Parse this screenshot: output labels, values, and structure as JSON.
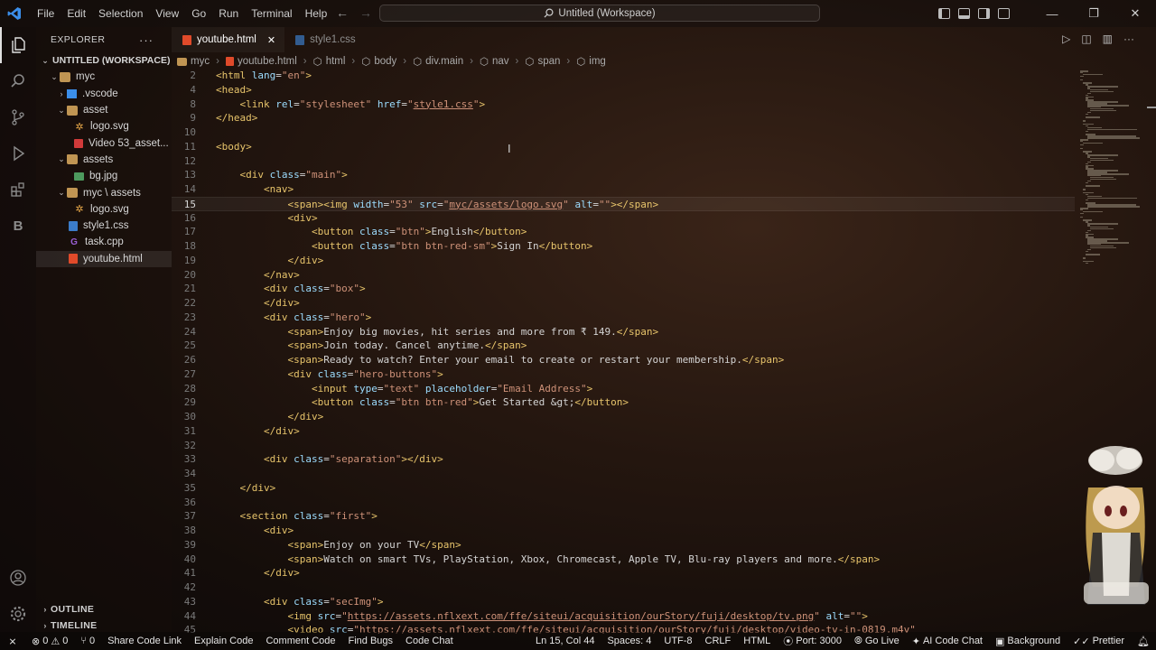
{
  "menu": [
    "File",
    "Edit",
    "Selection",
    "View",
    "Go",
    "Run",
    "Terminal",
    "Help"
  ],
  "command_center": "Untitled (Workspace)",
  "colors": {
    "accent": "#e7c46b",
    "attr": "#9cdcfe",
    "string": "#ce9178",
    "vscode_blue": "#3b8eea"
  },
  "explorer": {
    "title": "EXPLORER",
    "workspace": "UNTITLED (WORKSPACE)",
    "items": [
      {
        "label": "myc",
        "icon": "folder-open-icon"
      },
      {
        "label": ".vscode",
        "icon": "folder-icon"
      },
      {
        "label": "asset",
        "icon": "folder-open-icon"
      },
      {
        "label": "logo.svg",
        "icon": "svg-icon"
      },
      {
        "label": "Video 53_asset...",
        "icon": "video-icon"
      },
      {
        "label": "assets",
        "icon": "folder-open-icon"
      },
      {
        "label": "bg.jpg",
        "icon": "image-icon"
      },
      {
        "label": "myc \\ assets",
        "icon": "folder-open-icon"
      },
      {
        "label": "logo.svg",
        "icon": "svg-icon"
      },
      {
        "label": "style1.css",
        "icon": "css-icon"
      },
      {
        "label": "task.cpp",
        "icon": "cpp-icon"
      },
      {
        "label": "youtube.html",
        "icon": "html-icon"
      }
    ],
    "outline": "OUTLINE",
    "timeline": "TIMELINE"
  },
  "tabs": [
    {
      "label": "youtube.html",
      "active": true
    },
    {
      "label": "style1.css",
      "active": false
    }
  ],
  "breadcrumb": [
    "myc",
    "youtube.html",
    "html",
    "body",
    "div.main",
    "nav",
    "span",
    "img"
  ],
  "code_lines": [
    {
      "n": "2",
      "tokens": [
        [
          "t",
          "<html "
        ],
        [
          "a",
          "lang"
        ],
        [
          "x",
          "="
        ],
        [
          "s",
          "\"en\""
        ],
        [
          "t",
          ">"
        ]
      ]
    },
    {
      "n": "4",
      "tokens": [
        [
          "t",
          "<head>"
        ]
      ]
    },
    {
      "n": "8",
      "tokens": [
        [
          "x",
          "    "
        ],
        [
          "t",
          "<link "
        ],
        [
          "a",
          "rel"
        ],
        [
          "x",
          "="
        ],
        [
          "s",
          "\"stylesheet\""
        ],
        [
          "x",
          " "
        ],
        [
          "a",
          "href"
        ],
        [
          "x",
          "="
        ],
        [
          "s",
          "\""
        ],
        [
          "l",
          "style1.css"
        ],
        [
          "s",
          "\""
        ],
        [
          "t",
          ">"
        ]
      ]
    },
    {
      "n": "9",
      "tokens": [
        [
          "t",
          "</head>"
        ]
      ]
    },
    {
      "n": "10",
      "tokens": []
    },
    {
      "n": "11",
      "tokens": [
        [
          "t",
          "<body>"
        ]
      ]
    },
    {
      "n": "12",
      "tokens": []
    },
    {
      "n": "13",
      "tokens": [
        [
          "x",
          "    "
        ],
        [
          "t",
          "<div "
        ],
        [
          "a",
          "class"
        ],
        [
          "x",
          "="
        ],
        [
          "s",
          "\"main\""
        ],
        [
          "t",
          ">"
        ]
      ]
    },
    {
      "n": "14",
      "tokens": [
        [
          "x",
          "        "
        ],
        [
          "t",
          "<nav>"
        ]
      ]
    },
    {
      "n": "15",
      "current": true,
      "tokens": [
        [
          "x",
          "            "
        ],
        [
          "t",
          "<span><img "
        ],
        [
          "a",
          "width"
        ],
        [
          "x",
          "="
        ],
        [
          "s",
          "\"53\""
        ],
        [
          "x",
          " "
        ],
        [
          "a",
          "src"
        ],
        [
          "x",
          "="
        ],
        [
          "s",
          "\""
        ],
        [
          "l",
          "myc/assets/logo.svg"
        ],
        [
          "s",
          "\""
        ],
        [
          "x",
          " "
        ],
        [
          "a",
          "alt"
        ],
        [
          "x",
          "="
        ],
        [
          "s",
          "\"\""
        ],
        [
          "t",
          "></span>"
        ]
      ]
    },
    {
      "n": "16",
      "tokens": [
        [
          "x",
          "            "
        ],
        [
          "t",
          "<div>"
        ]
      ]
    },
    {
      "n": "17",
      "tokens": [
        [
          "x",
          "                "
        ],
        [
          "t",
          "<button "
        ],
        [
          "a",
          "class"
        ],
        [
          "x",
          "="
        ],
        [
          "s",
          "\"btn\""
        ],
        [
          "t",
          ">"
        ],
        [
          "x",
          "English"
        ],
        [
          "t",
          "</button>"
        ]
      ]
    },
    {
      "n": "18",
      "tokens": [
        [
          "x",
          "                "
        ],
        [
          "t",
          "<button "
        ],
        [
          "a",
          "class"
        ],
        [
          "x",
          "="
        ],
        [
          "s",
          "\"btn btn-red-sm\""
        ],
        [
          "t",
          ">"
        ],
        [
          "x",
          "Sign In"
        ],
        [
          "t",
          "</button>"
        ]
      ]
    },
    {
      "n": "19",
      "tokens": [
        [
          "x",
          "            "
        ],
        [
          "t",
          "</div>"
        ]
      ]
    },
    {
      "n": "20",
      "tokens": [
        [
          "x",
          "        "
        ],
        [
          "t",
          "</nav>"
        ]
      ]
    },
    {
      "n": "21",
      "tokens": [
        [
          "x",
          "        "
        ],
        [
          "t",
          "<div "
        ],
        [
          "a",
          "class"
        ],
        [
          "x",
          "="
        ],
        [
          "s",
          "\"box\""
        ],
        [
          "t",
          ">"
        ]
      ]
    },
    {
      "n": "22",
      "tokens": [
        [
          "x",
          "        "
        ],
        [
          "t",
          "</div>"
        ]
      ]
    },
    {
      "n": "23",
      "tokens": [
        [
          "x",
          "        "
        ],
        [
          "t",
          "<div "
        ],
        [
          "a",
          "class"
        ],
        [
          "x",
          "="
        ],
        [
          "s",
          "\"hero\""
        ],
        [
          "t",
          ">"
        ]
      ]
    },
    {
      "n": "24",
      "tokens": [
        [
          "x",
          "            "
        ],
        [
          "t",
          "<span>"
        ],
        [
          "x",
          "Enjoy big movies, hit series and more from ₹ 149."
        ],
        [
          "t",
          "</span>"
        ]
      ]
    },
    {
      "n": "25",
      "tokens": [
        [
          "x",
          "            "
        ],
        [
          "t",
          "<span>"
        ],
        [
          "x",
          "Join today. Cancel anytime."
        ],
        [
          "t",
          "</span>"
        ]
      ]
    },
    {
      "n": "26",
      "tokens": [
        [
          "x",
          "            "
        ],
        [
          "t",
          "<span>"
        ],
        [
          "x",
          "Ready to watch? Enter your email to create or restart your membership."
        ],
        [
          "t",
          "</span>"
        ]
      ]
    },
    {
      "n": "27",
      "tokens": [
        [
          "x",
          "            "
        ],
        [
          "t",
          "<div "
        ],
        [
          "a",
          "class"
        ],
        [
          "x",
          "="
        ],
        [
          "s",
          "\"hero-buttons\""
        ],
        [
          "t",
          ">"
        ]
      ]
    },
    {
      "n": "28",
      "tokens": [
        [
          "x",
          "                "
        ],
        [
          "t",
          "<input "
        ],
        [
          "a",
          "type"
        ],
        [
          "x",
          "="
        ],
        [
          "s",
          "\"text\""
        ],
        [
          "x",
          " "
        ],
        [
          "a",
          "placeholder"
        ],
        [
          "x",
          "="
        ],
        [
          "s",
          "\"Email Address\""
        ],
        [
          "t",
          ">"
        ]
      ]
    },
    {
      "n": "29",
      "tokens": [
        [
          "x",
          "                "
        ],
        [
          "t",
          "<button "
        ],
        [
          "a",
          "class"
        ],
        [
          "x",
          "="
        ],
        [
          "s",
          "\"btn btn-red\""
        ],
        [
          "t",
          ">"
        ],
        [
          "x",
          "Get Started &gt;"
        ],
        [
          "t",
          "</button>"
        ]
      ]
    },
    {
      "n": "30",
      "tokens": [
        [
          "x",
          "            "
        ],
        [
          "t",
          "</div>"
        ]
      ]
    },
    {
      "n": "31",
      "tokens": [
        [
          "x",
          "        "
        ],
        [
          "t",
          "</div>"
        ]
      ]
    },
    {
      "n": "32",
      "tokens": []
    },
    {
      "n": "33",
      "tokens": [
        [
          "x",
          "        "
        ],
        [
          "t",
          "<div "
        ],
        [
          "a",
          "class"
        ],
        [
          "x",
          "="
        ],
        [
          "s",
          "\"separation\""
        ],
        [
          "t",
          "></div>"
        ]
      ]
    },
    {
      "n": "34",
      "tokens": []
    },
    {
      "n": "35",
      "tokens": [
        [
          "x",
          "    "
        ],
        [
          "t",
          "</div>"
        ]
      ]
    },
    {
      "n": "36",
      "tokens": []
    },
    {
      "n": "37",
      "tokens": [
        [
          "x",
          "    "
        ],
        [
          "t",
          "<section "
        ],
        [
          "a",
          "class"
        ],
        [
          "x",
          "="
        ],
        [
          "s",
          "\"first\""
        ],
        [
          "t",
          ">"
        ]
      ]
    },
    {
      "n": "38",
      "tokens": [
        [
          "x",
          "        "
        ],
        [
          "t",
          "<div>"
        ]
      ]
    },
    {
      "n": "39",
      "tokens": [
        [
          "x",
          "            "
        ],
        [
          "t",
          "<span>"
        ],
        [
          "x",
          "Enjoy on your TV"
        ],
        [
          "t",
          "</span>"
        ]
      ]
    },
    {
      "n": "40",
      "tokens": [
        [
          "x",
          "            "
        ],
        [
          "t",
          "<span>"
        ],
        [
          "x",
          "Watch on smart TVs, PlayStation, Xbox, Chromecast, Apple TV, Blu-ray players and more."
        ],
        [
          "t",
          "</span>"
        ]
      ]
    },
    {
      "n": "41",
      "tokens": [
        [
          "x",
          "        "
        ],
        [
          "t",
          "</div>"
        ]
      ]
    },
    {
      "n": "42",
      "tokens": []
    },
    {
      "n": "43",
      "tokens": [
        [
          "x",
          "        "
        ],
        [
          "t",
          "<div "
        ],
        [
          "a",
          "class"
        ],
        [
          "x",
          "="
        ],
        [
          "s",
          "\"secImg\""
        ],
        [
          "t",
          ">"
        ]
      ]
    },
    {
      "n": "44",
      "tokens": [
        [
          "x",
          "            "
        ],
        [
          "t",
          "<img "
        ],
        [
          "a",
          "src"
        ],
        [
          "x",
          "="
        ],
        [
          "s",
          "\""
        ],
        [
          "l",
          "https://assets.nflxext.com/ffe/siteui/acquisition/ourStory/fuji/desktop/tv.png"
        ],
        [
          "s",
          "\""
        ],
        [
          "x",
          " "
        ],
        [
          "a",
          "alt"
        ],
        [
          "x",
          "="
        ],
        [
          "s",
          "\"\""
        ],
        [
          "t",
          ">"
        ]
      ]
    },
    {
      "n": "45",
      "tokens": [
        [
          "x",
          "            "
        ],
        [
          "t",
          "<video "
        ],
        [
          "a",
          "src"
        ],
        [
          "x",
          "="
        ],
        [
          "s",
          "\""
        ],
        [
          "l",
          "https://assets.nflxext.com/ffe/siteui/acquisition/ourStory/fuji/desktop/video-tv-in-0819.m4v"
        ],
        [
          "s",
          "\""
        ]
      ]
    }
  ],
  "status": {
    "errors": "0",
    "warnings": "0",
    "ports": "0",
    "share": "Share Code Link",
    "explain": "Explain Code",
    "comment": "Comment Code",
    "bugs": "Find Bugs",
    "chat": "Code Chat",
    "position": "Ln 15, Col 44",
    "spaces": "Spaces: 4",
    "encoding": "UTF-8",
    "eol": "CRLF",
    "language": "HTML",
    "port": "Port: 3000",
    "golive": "Go Live",
    "ai_chat": "AI Code Chat",
    "background": "Background",
    "prettier": "Prettier"
  }
}
